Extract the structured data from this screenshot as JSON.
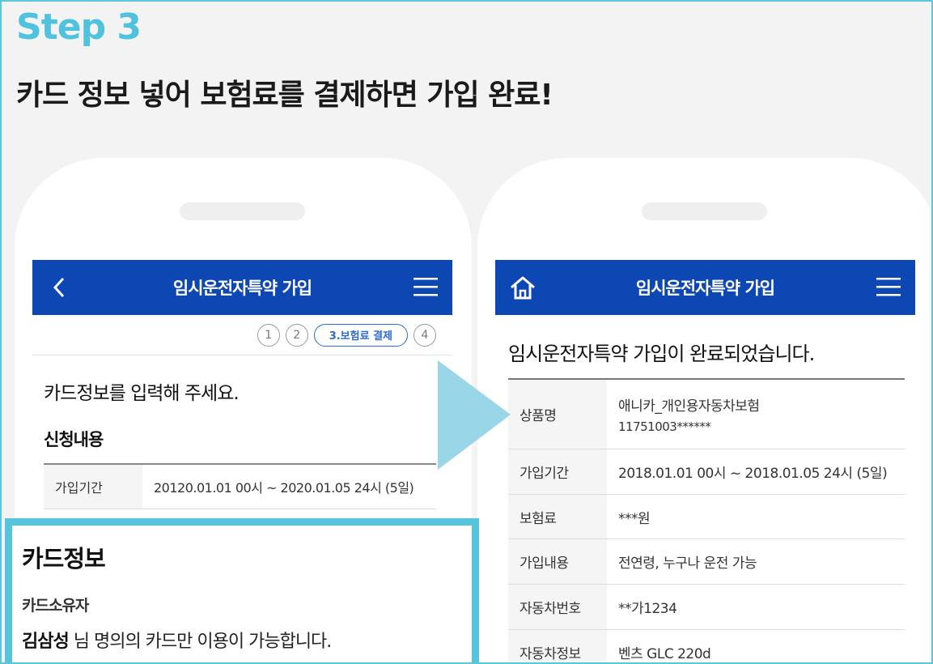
{
  "step_label": "Step 3",
  "headline": "카드 정보 넣어 보험료를 결제하면 가입 완료!",
  "left_screen": {
    "title": "임시운전자특약 가입",
    "steps": [
      "1",
      "2",
      "3.보험료 결제",
      "4"
    ],
    "prompt": "카드정보를 입력해 주세요.",
    "section_title": "신청내용",
    "period_label": "가입기간",
    "period_value": "20120.01.01 00시 ~ 2020.01.05 24시 (5일)"
  },
  "card_info": {
    "title": "카드정보",
    "owner_label": "카드소유자",
    "owner_name": "김삼성",
    "notice": " 님 명의의 카드만 이용이 가능합니다."
  },
  "right_screen": {
    "title": "임시운전자특약 가입",
    "complete_message": "임시운전자특약 가입이 완료되었습니다.",
    "rows": [
      {
        "label": "상품명",
        "value": "애니카_개인용자동차보험",
        "sub": "11751003******"
      },
      {
        "label": "가입기간",
        "value": "2018.01.01 00시 ~ 2018.01.05 24시 (5일)"
      },
      {
        "label": "보험료",
        "value": "***원"
      },
      {
        "label": "가입내용",
        "value": "전연령, 누구나 운전 가능"
      },
      {
        "label": "자동차번호",
        "value": "**가1234"
      },
      {
        "label": "자동차정보",
        "value": "벤츠 GLC 220d"
      }
    ]
  },
  "colors": {
    "accent": "#4fc2dd",
    "appbar": "#0d47b3",
    "step_active": "#2c6bd3",
    "arrow": "#8fd3e6"
  },
  "icons": {
    "back": "chevron-left-icon",
    "menu": "hamburger-menu-icon",
    "home": "home-icon",
    "arrow": "play-arrow-icon"
  }
}
